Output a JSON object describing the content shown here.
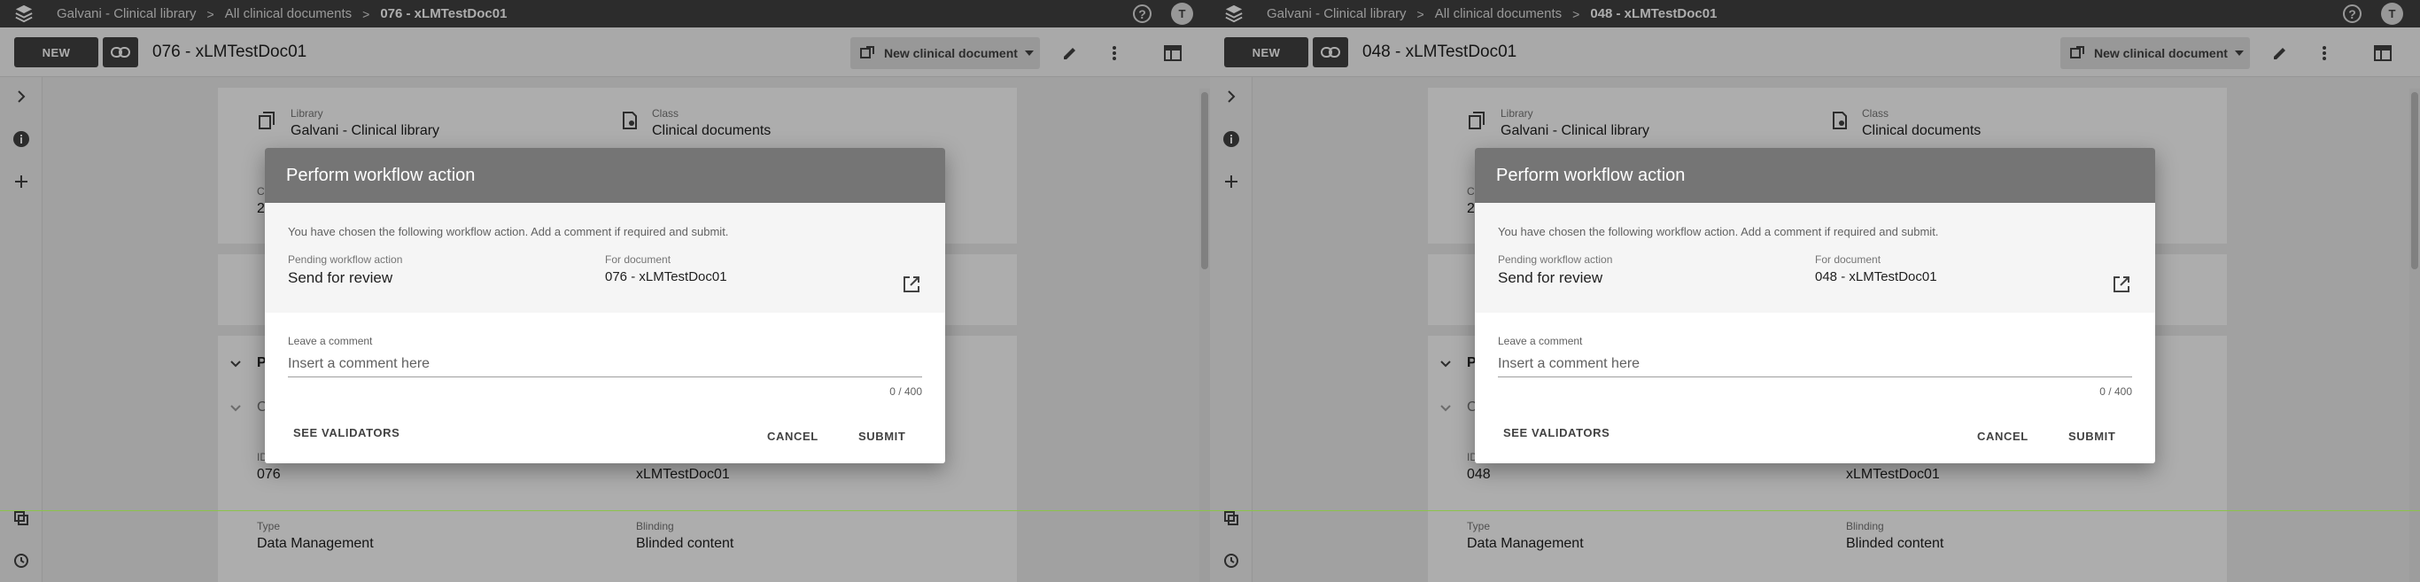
{
  "colors": {
    "topbar": "#424242",
    "primary_button": "#424242",
    "dialog_header": "#757575",
    "overlay": "rgba(0,0,0,0.32)",
    "guide_line": "#8bc34a"
  },
  "panels": [
    {
      "breadcrumb": [
        "Galvani - Clinical library",
        "All clinical documents",
        "076 - xLMTestDoc01"
      ],
      "avatar_initial": "T",
      "toolbar": {
        "new_label": "NEW",
        "title": "076 - xLMTestDoc01",
        "new_doc_label": "New clinical document"
      },
      "meta": {
        "library_label": "Library",
        "library_value": "Galvani - Clinical library",
        "class_label": "Class",
        "class_value": "Clinical documents",
        "partial_c": "C",
        "partial_2": "2",
        "section_p": "P",
        "section_c": "C",
        "id_label": "ID",
        "id_value": "076",
        "name_value": "xLMTestDoc01",
        "type_label": "Type",
        "type_value": "Data Management",
        "blinding_label": "Blinding",
        "blinding_value": "Blinded content"
      },
      "dialog": {
        "title": "Perform workflow action",
        "description": "You have chosen the following workflow action. Add a comment if required and submit.",
        "pending_label": "Pending workflow action",
        "pending_value": "Send for review",
        "for_doc_label": "For document",
        "for_doc_value": "076 - xLMTestDoc01",
        "comment_label": "Leave a comment",
        "comment_placeholder": "Insert a comment here",
        "comment_value": "",
        "char_count": "0 / 400",
        "see_validators": "SEE VALIDATORS",
        "cancel": "CANCEL",
        "submit": "SUBMIT"
      }
    },
    {
      "breadcrumb": [
        "Galvani - Clinical library",
        "All clinical documents",
        "048 - xLMTestDoc01"
      ],
      "avatar_initial": "T",
      "toolbar": {
        "new_label": "NEW",
        "title": "048 - xLMTestDoc01",
        "new_doc_label": "New clinical document"
      },
      "meta": {
        "library_label": "Library",
        "library_value": "Galvani - Clinical library",
        "class_label": "Class",
        "class_value": "Clinical documents",
        "partial_c": "C",
        "partial_2": "2",
        "section_p": "P",
        "section_c": "C",
        "id_label": "ID",
        "id_value": "048",
        "name_value": "xLMTestDoc01",
        "type_label": "Type",
        "type_value": "Data Management",
        "blinding_label": "Blinding",
        "blinding_value": "Blinded content"
      },
      "dialog": {
        "title": "Perform workflow action",
        "description": "You have chosen the following workflow action. Add a comment if required and submit.",
        "pending_label": "Pending workflow action",
        "pending_value": "Send for review",
        "for_doc_label": "For document",
        "for_doc_value": "048 - xLMTestDoc01",
        "comment_label": "Leave a comment",
        "comment_placeholder": "Insert a comment here",
        "comment_value": "",
        "char_count": "0 / 400",
        "see_validators": "SEE VALIDATORS",
        "cancel": "CANCEL",
        "submit": "SUBMIT"
      }
    }
  ]
}
